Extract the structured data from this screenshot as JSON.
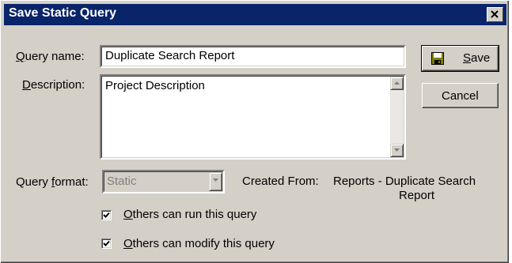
{
  "dialog": {
    "title": "Save Static Query",
    "close_icon": "close-icon"
  },
  "form": {
    "query_name": {
      "label_mnemonic": "Q",
      "label_rest": "uery name:",
      "value": "Duplicate Search Report"
    },
    "description": {
      "label_mnemonic": "D",
      "label_rest": "escription:",
      "value": "Project Description"
    },
    "query_format": {
      "label_prefix": "Query ",
      "label_mnemonic": "f",
      "label_rest": "ormat:",
      "value": "Static",
      "disabled": true
    },
    "created_from": {
      "label": "Created From:",
      "value_line1": "Reports - Duplicate Search",
      "value_line2": "Report"
    },
    "others_run": {
      "mnemonic": "O",
      "rest": "thers can run this query",
      "checked": true
    },
    "others_modify": {
      "mnemonic": "O",
      "rest": "thers can modify this query",
      "checked": true
    }
  },
  "buttons": {
    "save": {
      "mnemonic": "S",
      "rest": "ave",
      "icon": "floppy-disk-icon"
    },
    "cancel": {
      "label": "Cancel"
    }
  },
  "colors": {
    "title_bar": "#0a246a",
    "face": "#d4d0c8",
    "disabled_text": "#808080",
    "floppy_icon": "#808000"
  }
}
